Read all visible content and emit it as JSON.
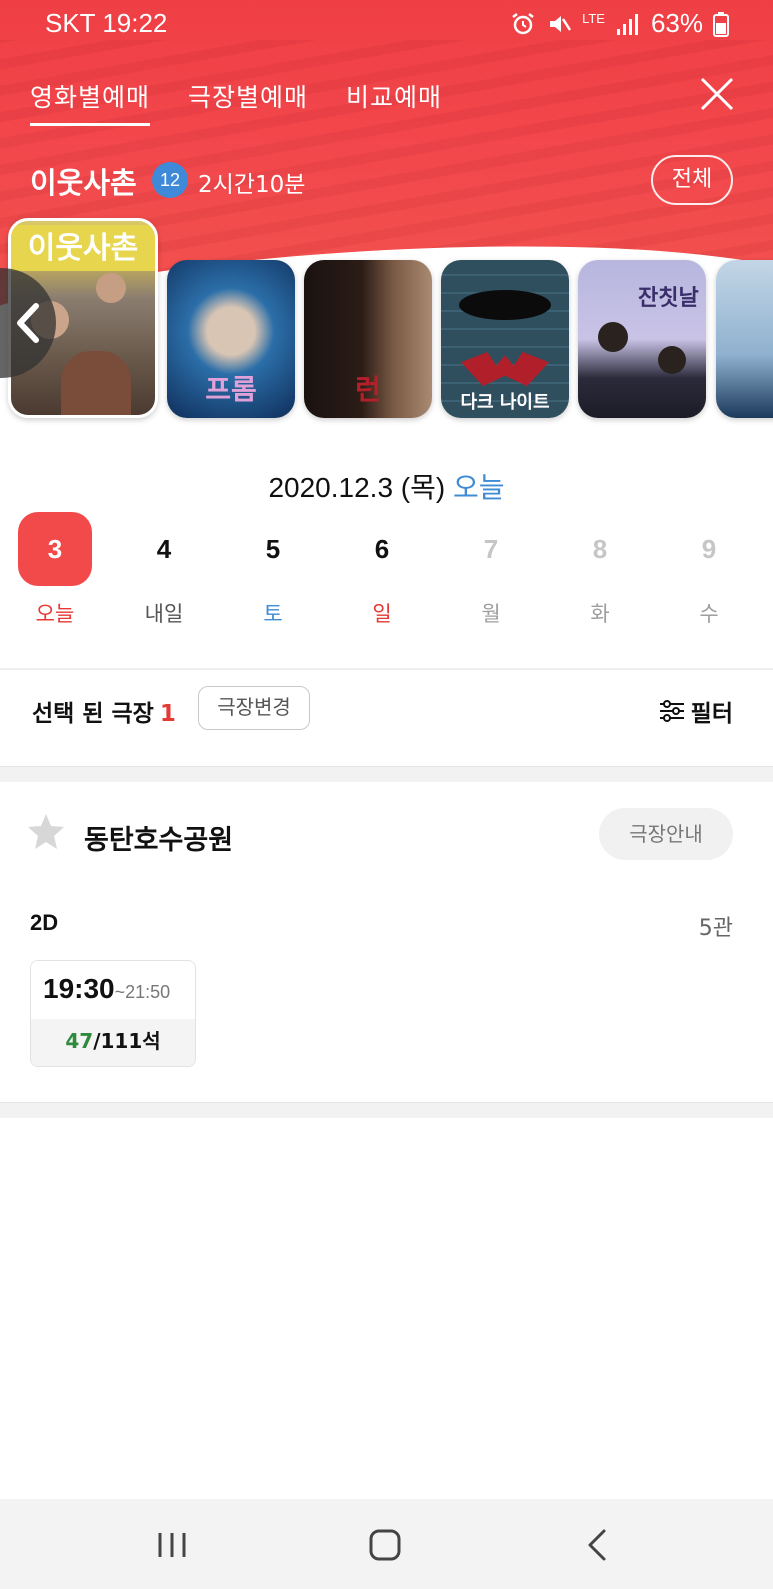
{
  "status_bar": {
    "carrier_time": "SKT 19:22",
    "network": "LTE",
    "battery": "63%"
  },
  "tabs": [
    {
      "label": "영화별예매",
      "active": true
    },
    {
      "label": "극장별예매",
      "active": false
    },
    {
      "label": "비교예매",
      "active": false
    }
  ],
  "movie": {
    "title": "이웃사촌",
    "age_rating": "12",
    "runtime": "2시간10분",
    "all_button": "전체"
  },
  "posters": [
    {
      "text": "이웃사촌",
      "selected": true
    },
    {
      "text": "프롬",
      "selected": false
    },
    {
      "text": "런",
      "selected": false
    },
    {
      "text": "다크 나이트",
      "selected": false
    },
    {
      "text": "잔칫날",
      "selected": false
    },
    {
      "text": "",
      "selected": false
    }
  ],
  "date": {
    "full": "2020.12.3 (목)",
    "today_label": "오늘"
  },
  "days": [
    {
      "num": "3",
      "label": "오늘",
      "state": "selected",
      "label_color": "#e53935"
    },
    {
      "num": "4",
      "label": "내일",
      "state": "normal",
      "label_color": "#555555"
    },
    {
      "num": "5",
      "label": "토",
      "state": "normal",
      "label_color": "#3f8bd4"
    },
    {
      "num": "6",
      "label": "일",
      "state": "normal",
      "label_color": "#e53935"
    },
    {
      "num": "7",
      "label": "월",
      "state": "disabled",
      "label_color": "#9e9e9e"
    },
    {
      "num": "8",
      "label": "화",
      "state": "disabled",
      "label_color": "#9e9e9e"
    },
    {
      "num": "9",
      "label": "수",
      "state": "disabled",
      "label_color": "#9e9e9e"
    }
  ],
  "theater_selection": {
    "label": "선택 된 극장",
    "count": "1",
    "change_button": "극장변경",
    "filter_label": "필터"
  },
  "theater": {
    "name": "동탄호수공원",
    "info_button": "극장안내",
    "format": "2D",
    "hall": "5관",
    "showtimes": [
      {
        "start": "19:30",
        "end": "~21:50",
        "available": "47",
        "total": "/111석"
      }
    ]
  },
  "colors": {
    "brand_red": "#f2474c",
    "selected_day": "#f24a4a",
    "today_blue": "#3f8bd4",
    "seats_green": "#2e8b3d"
  }
}
